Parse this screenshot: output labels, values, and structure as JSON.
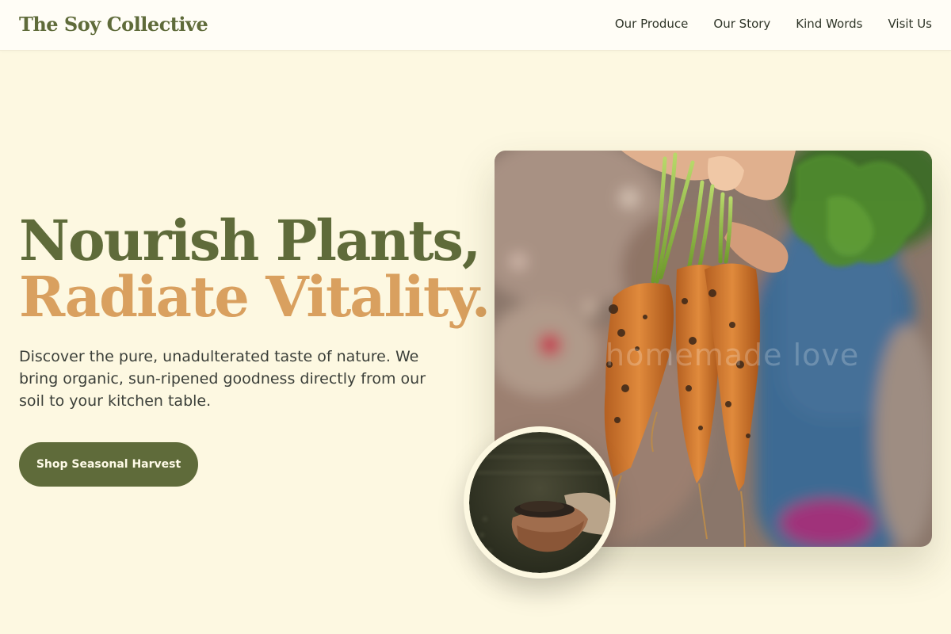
{
  "brand": {
    "name": "The Soy Collective"
  },
  "nav": {
    "items": [
      {
        "label": "Our Produce"
      },
      {
        "label": "Our Story"
      },
      {
        "label": "Kind Words"
      },
      {
        "label": "Visit Us"
      }
    ]
  },
  "hero": {
    "headline_line1": "Nourish Plants,",
    "headline_line2": "Radiate Vitality.",
    "description": "Discover the pure, unadulterated taste of nature. We bring organic, sun-ripened goodness directly from our soil to your kitchen table.",
    "cta_label": "Shop Seasonal Harvest",
    "photo_watermark": "homemade love"
  },
  "colors": {
    "page_background": "#fdf8e1",
    "brand_green": "#5f6b3a",
    "accent_orange": "#d9a05f",
    "body_text": "#3b3f39"
  },
  "images": {
    "hero_photo": "hand-holding-fresh-carrots-photo",
    "inset_photo": "hands-holding-soil-photo"
  }
}
